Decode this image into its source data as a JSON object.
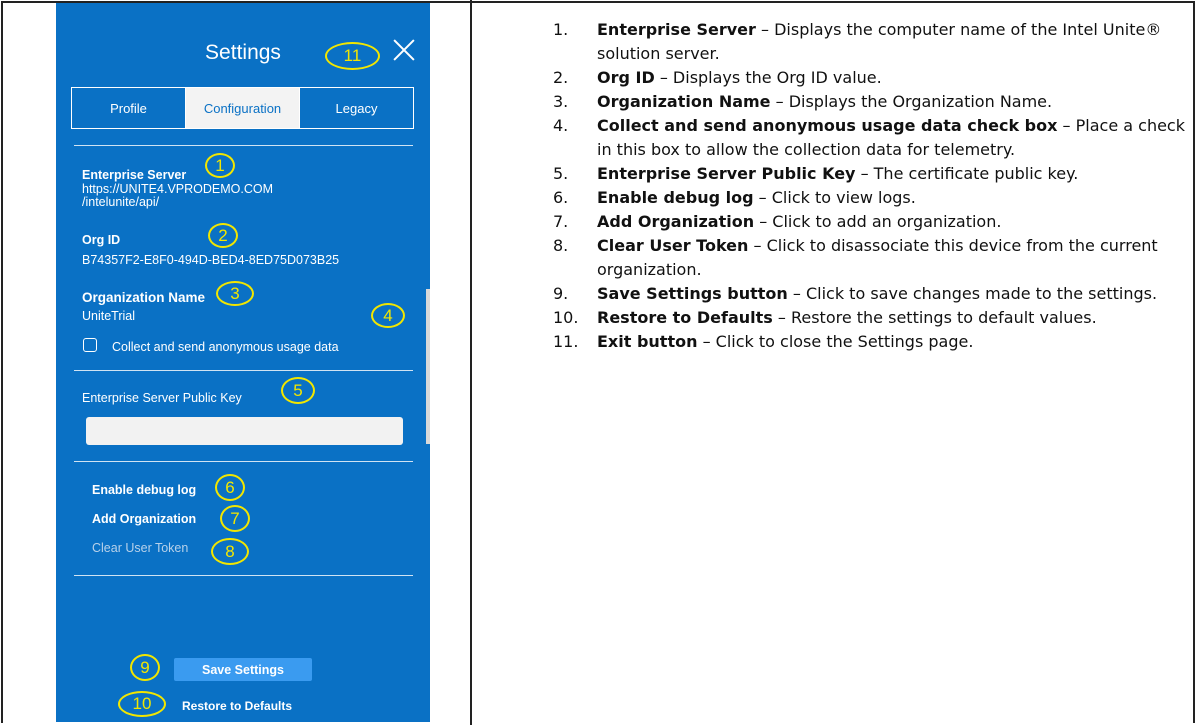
{
  "settings": {
    "title": "Settings",
    "tabs": [
      {
        "label": "Profile",
        "active": false
      },
      {
        "label": "Configuration",
        "active": true
      },
      {
        "label": "Legacy",
        "active": false
      }
    ],
    "enterprise_server": {
      "label": "Enterprise Server",
      "value_line1": "https://UNITE4.VPRODEMO.COM",
      "value_line2": "/intelunite/api/"
    },
    "org_id": {
      "label": "Org ID",
      "value": "B74357F2-E8F0-494D-BED4-8ED75D073B25"
    },
    "org_name": {
      "label": "Organization Name",
      "value": "UniteTrial"
    },
    "usage_checkbox": {
      "label": "Collect and send anonymous usage data",
      "checked": false
    },
    "public_key": {
      "label": "Enterprise Server Public Key",
      "value": ""
    },
    "links": {
      "debug_log": "Enable debug log",
      "add_org": "Add Organization",
      "clear_token": "Clear User Token"
    },
    "save_button": "Save Settings",
    "restore_button": "Restore to Defaults"
  },
  "callouts": [
    "1",
    "2",
    "3",
    "4",
    "5",
    "6",
    "7",
    "8",
    "9",
    "10",
    "11"
  ],
  "colors": {
    "panel_blue": "#0a71c5",
    "callout_yellow": "#f2e600",
    "save_button": "#3a9bf0"
  },
  "descriptions": [
    {
      "num": "1.",
      "term": "Enterprise Server",
      "text": " – Displays the computer name of the Intel Unite® solution server."
    },
    {
      "num": "2.",
      "term": "Org ID",
      "text": " – Displays the Org ID value."
    },
    {
      "num": "3.",
      "term": "Organization Name",
      "text": " – Displays the Organization Name."
    },
    {
      "num": "4.",
      "term": "Collect and send anonymous usage data check box",
      "text": " – Place a check in this box to allow the collection data for telemetry."
    },
    {
      "num": "5.",
      "term": "Enterprise Server Public Key",
      "text": " – The certificate public key."
    },
    {
      "num": "6.",
      "term": "Enable debug log",
      "text": " – Click to view logs."
    },
    {
      "num": "7.",
      "term": "Add Organization",
      "text": " – Click to add an organization."
    },
    {
      "num": "8.",
      "term": "Clear User Token",
      "text": " – Click to disassociate this device from the current organization."
    },
    {
      "num": "9.",
      "term": "Save Settings button",
      "text": " – Click to save changes made to the settings."
    },
    {
      "num": "10.",
      "term": "Restore to Defaults",
      "text": " – Restore the settings to default values."
    },
    {
      "num": "11.",
      "term": "Exit button",
      "text": " – Click to close the Settings page."
    }
  ]
}
